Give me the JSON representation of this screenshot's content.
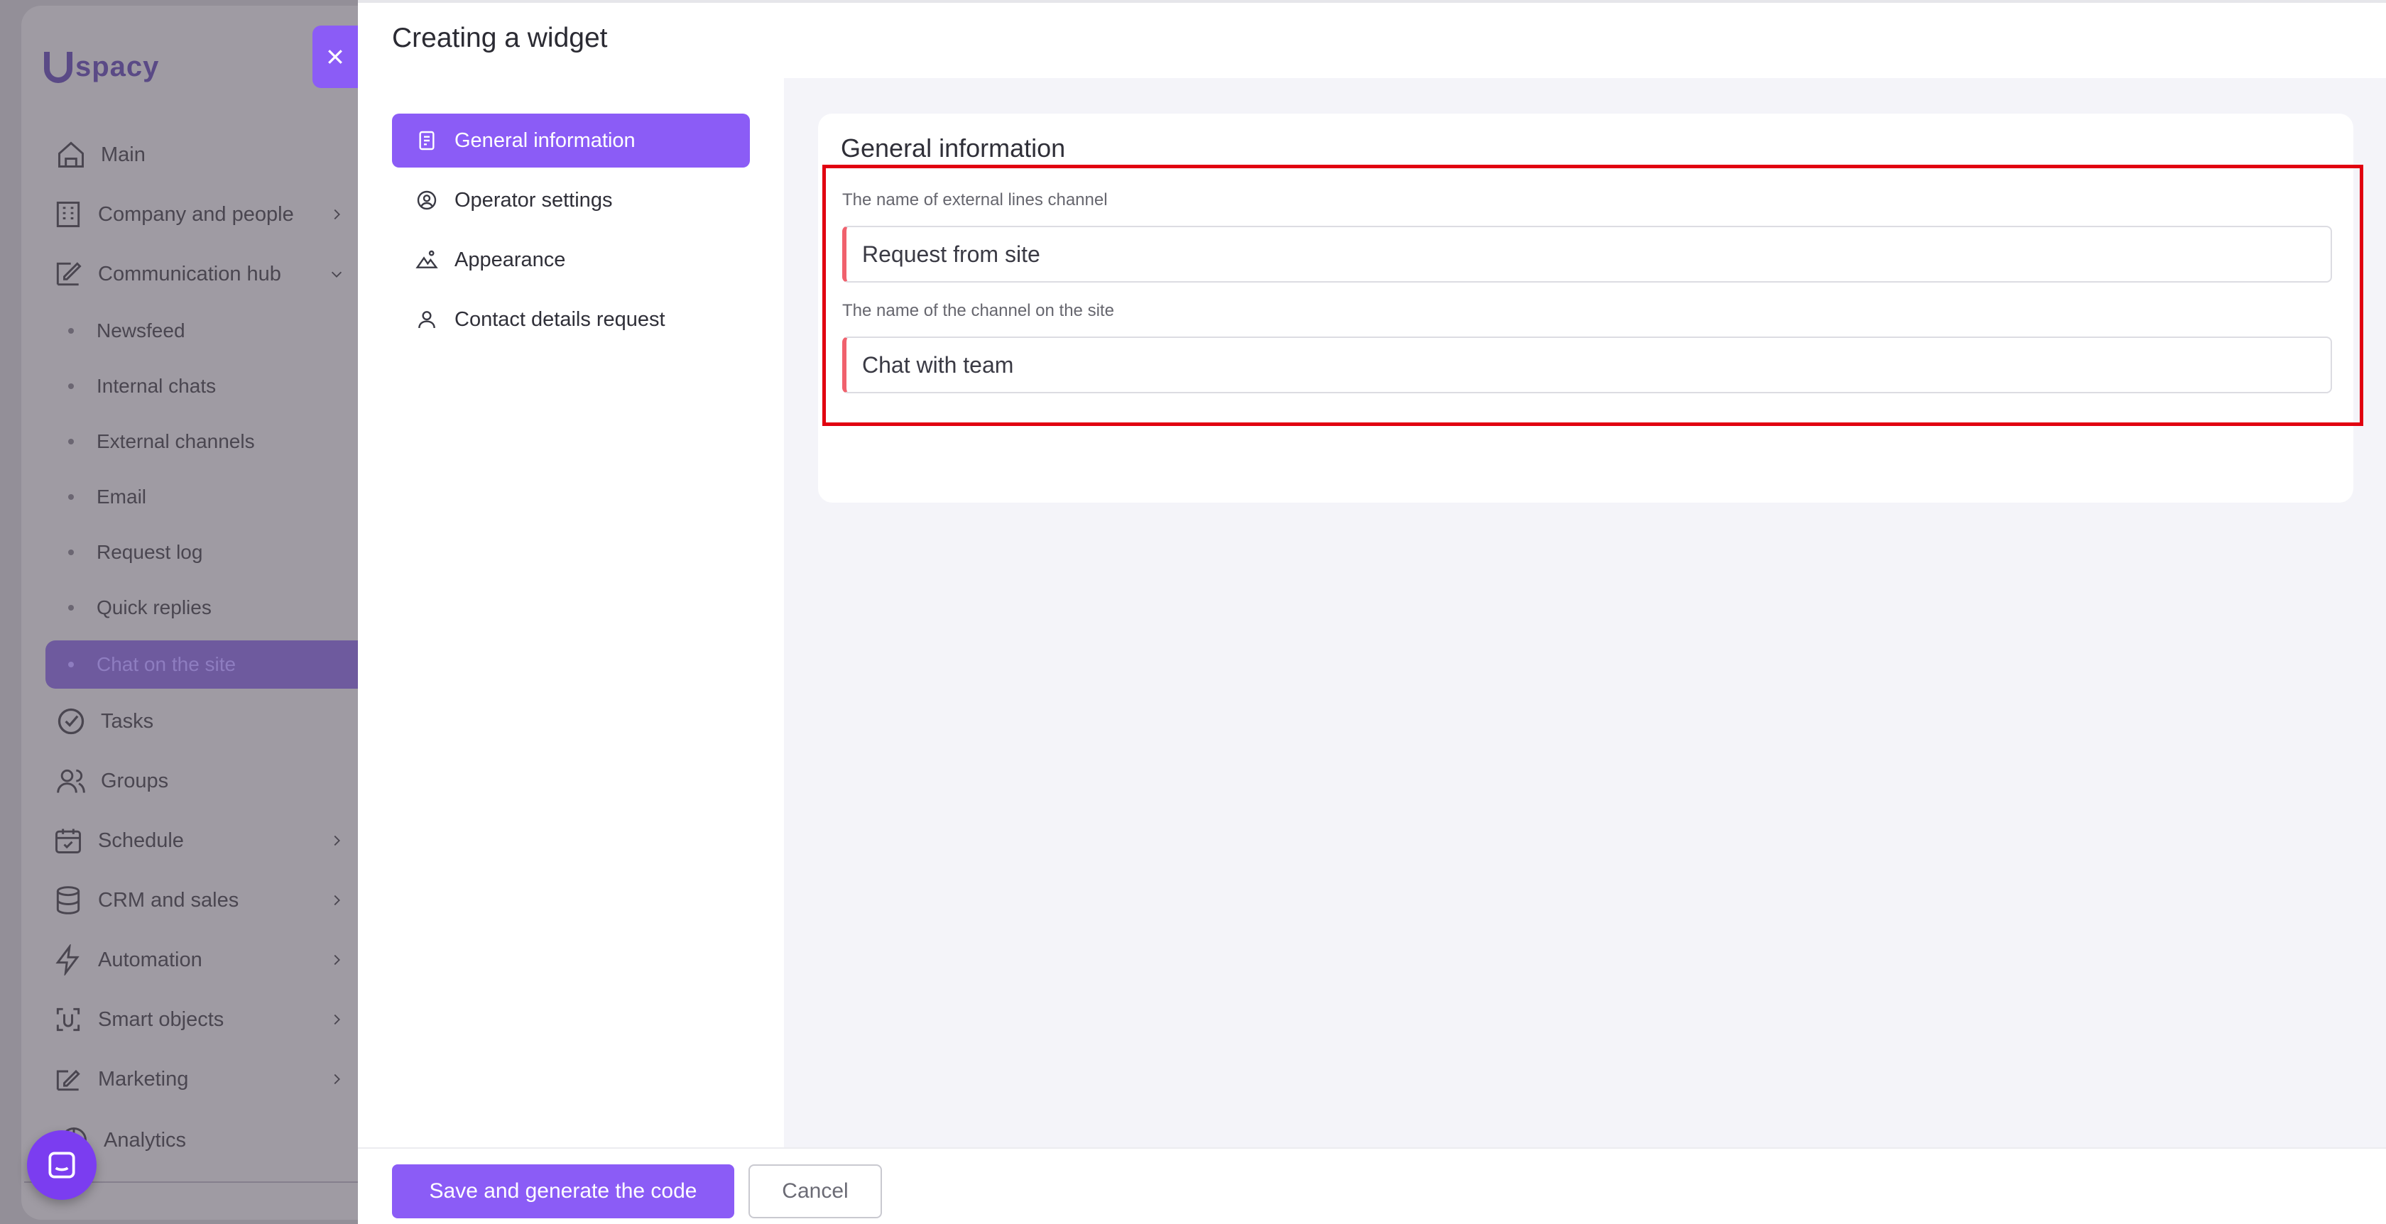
{
  "app": {
    "logo_text": "spacy",
    "nav": [
      {
        "label": "Main",
        "icon": "home-icon"
      },
      {
        "label": "Company and people",
        "icon": "building-icon"
      },
      {
        "label": "Communication hub",
        "icon": "chat-icon"
      },
      {
        "label": "Tasks",
        "icon": "check-circle-icon"
      },
      {
        "label": "Groups",
        "icon": "users-icon"
      },
      {
        "label": "Schedule",
        "icon": "calendar-icon"
      },
      {
        "label": "CRM and sales",
        "icon": "database-icon"
      },
      {
        "label": "Automation",
        "icon": "lightning-icon"
      },
      {
        "label": "Smart objects",
        "icon": "scan-icon"
      },
      {
        "label": "Marketing",
        "icon": "megaphone-icon"
      },
      {
        "label": "Analytics",
        "icon": "chart-icon"
      }
    ],
    "communication_hub_items": [
      "Newsfeed",
      "Internal chats",
      "External channels",
      "Email",
      "Request log",
      "Quick replies",
      "Chat on the site"
    ]
  },
  "panel": {
    "title": "Creating a widget",
    "tabs": [
      {
        "label": "General information",
        "icon": "document-icon"
      },
      {
        "label": "Operator settings",
        "icon": "user-circle-icon"
      },
      {
        "label": "Appearance",
        "icon": "image-icon"
      },
      {
        "label": "Contact details request",
        "icon": "user-icon"
      }
    ],
    "section_title": "General information",
    "fields": [
      {
        "label": "The name of external lines channel",
        "value": "Request from site"
      },
      {
        "label": "The name of the channel on the site",
        "value": "Chat with team"
      }
    ],
    "footer": {
      "save_label": "Save and generate the code",
      "cancel_label": "Cancel"
    }
  },
  "colors": {
    "accent": "#8b5cf6",
    "highlight": "#e10010",
    "field_marker": "#f0616d"
  }
}
